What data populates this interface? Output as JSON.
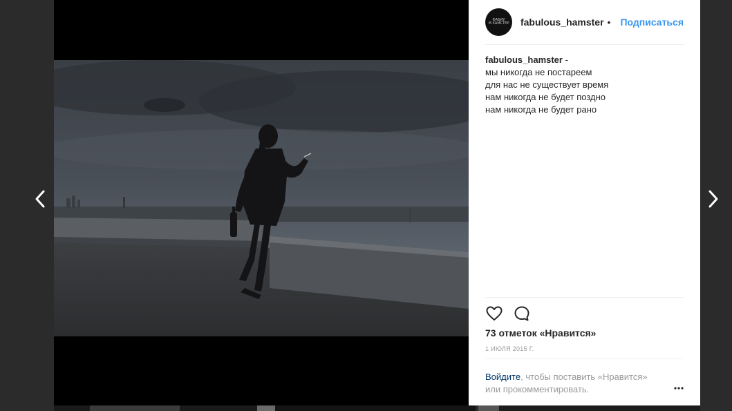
{
  "post": {
    "username": "fabulous_hamster",
    "separator_dot": "•",
    "follow_label": "Подписаться",
    "avatar_text": "ФАБИУ\nМ ХАМСТЕР",
    "caption": {
      "author": "fabulous_hamster",
      "dash": "-",
      "lines": [
        "мы никогда не постареем",
        "для нас не существует время",
        "нам никогда не будет поздно",
        "нам никогда не будет рано"
      ]
    },
    "likes_text": "73 отметок «Нравится»",
    "date_text": "1 ИЮЛЯ 2015 Г.",
    "login_prompt": {
      "link": "Войдите",
      "rest": ", чтобы поставить «Нравится» или прокомментировать."
    }
  },
  "icons": {
    "prev": "chevron-left-icon",
    "next": "chevron-right-icon",
    "like": "heart-icon",
    "comment": "comment-icon",
    "more": "more-options-icon"
  },
  "colors": {
    "follow": "#3897f0",
    "login_link": "#003569",
    "backdrop": "#2b2b2b",
    "panel": "#ffffff"
  }
}
